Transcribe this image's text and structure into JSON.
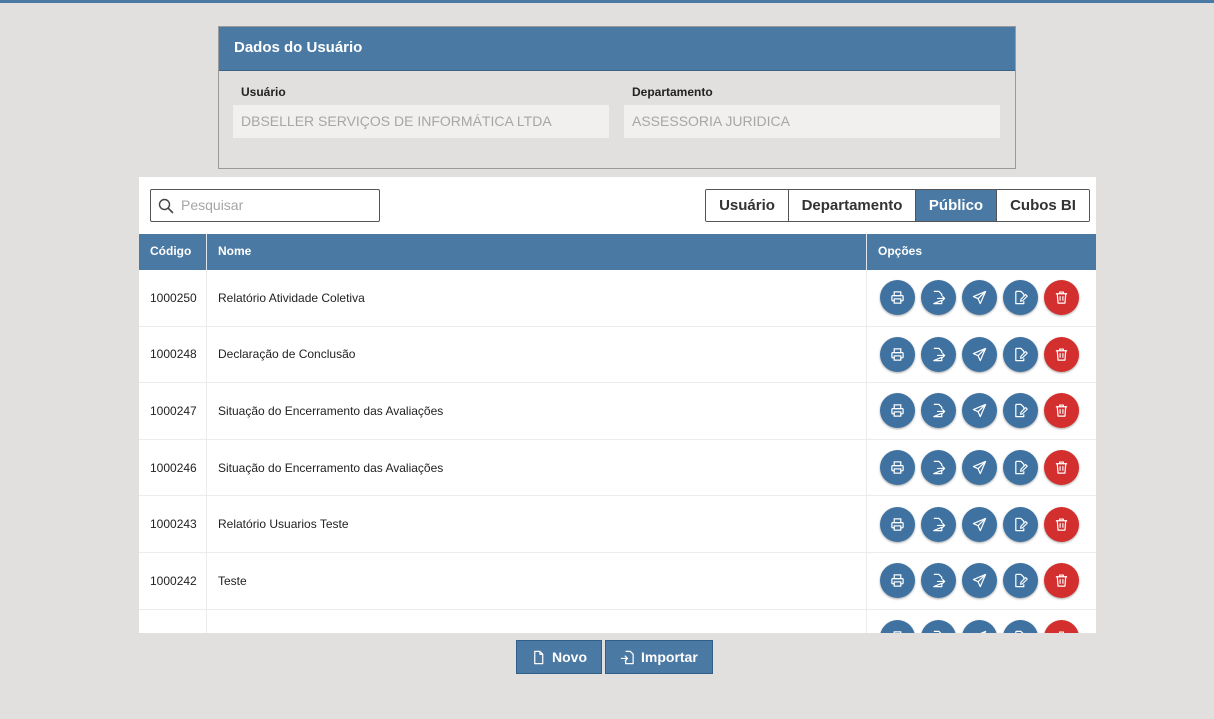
{
  "user_panel": {
    "title": "Dados do Usuário",
    "user_label": "Usuário",
    "user_value": "DBSELLER SERVIÇOS DE INFORMÁTICA LTDA",
    "dept_label": "Departamento",
    "dept_value": "ASSESSORIA JURIDICA"
  },
  "search": {
    "placeholder": "Pesquisar",
    "icon": "search-icon"
  },
  "filters": [
    "Usuário",
    "Departamento",
    "Público",
    "Cubos BI"
  ],
  "active_filter": "Público",
  "table": {
    "headers": {
      "code": "Código",
      "name": "Nome",
      "options": "Opções"
    },
    "rows": [
      {
        "code": "1000250",
        "name": "Relatório Atividade Coletiva"
      },
      {
        "code": "1000248",
        "name": "Declaração de Conclusão"
      },
      {
        "code": "1000247",
        "name": "Situação do Encerramento das Avaliações"
      },
      {
        "code": "1000246",
        "name": "Situação do Encerramento das Avaliações"
      },
      {
        "code": "1000243",
        "name": "Relatório Usuarios Teste"
      },
      {
        "code": "1000242",
        "name": "Teste"
      },
      {
        "code": "",
        "name": ""
      }
    ],
    "row_icons": [
      "print-icon",
      "export-icon",
      "send-icon",
      "edit-icon",
      "trash-icon"
    ]
  },
  "actions": {
    "new_label": "Novo",
    "import_label": "Importar"
  },
  "colors": {
    "primary": "#4a79a3",
    "danger": "#d32f2f",
    "background": "#e2e0de"
  }
}
